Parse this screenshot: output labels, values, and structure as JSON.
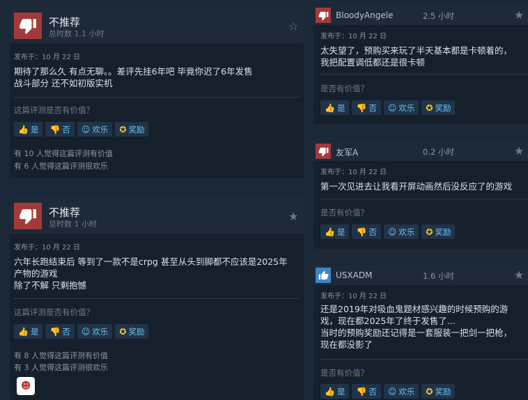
{
  "left_reviews": [
    {
      "verdict": "不推荐",
      "hours": "总时数 1.1 小时",
      "posted": "发布于：10 月 22 日",
      "text": "期待了那么久 有点无聊。。差评先挂6年吧 毕竟你迟了6年发售\n战斗部分 还不如初版实机",
      "helpful_question": "这篇评测是否有价值？",
      "buttons": {
        "yes": "是",
        "no": "否",
        "funny": "欢乐",
        "award": "奖励"
      },
      "helpful_count": "有 10 人觉得这篇评测有价值",
      "funny_count": "有 6 人觉得这篇评测很欢乐",
      "thumb": "thumbs-down",
      "star": "star-outline-icon"
    },
    {
      "verdict": "不推荐",
      "hours": "总时数 1 小时",
      "posted": "发布于：10 月 22 日",
      "text": "六年长跑结束后 等到了一款不是crpg 甚至从头到脚都不应该是2025年\n产物的游戏\n除了不解 只剩抱憾",
      "helpful_question": "这篇评测是否有价值？",
      "buttons": {
        "yes": "是",
        "no": "否",
        "funny": "欢乐",
        "award": "奖励"
      },
      "helpful_count": "有 8 人觉得这篇评测有价值",
      "funny_count": "有 3 人觉得这篇评测很欢乐",
      "thumb": "thumbs-down",
      "star": "star-filled-icon"
    }
  ],
  "right_reviews": [
    {
      "user": "BloodyAngele",
      "hours": "2.5 小时",
      "posted": "发布于：10 月 22 日",
      "text": "太失望了，预购买来玩了半天基本都是卡顿着的，\n我把配置调低都还是很卡顿",
      "helpful_question": "是否有价值？",
      "buttons": {
        "yes": "是",
        "no": "否",
        "funny": "欢乐",
        "award": "奖励"
      },
      "thumb": "thumbs-down"
    },
    {
      "user": "友军A",
      "hours": "0.2 小时",
      "posted": "发布于：10 月 22 日",
      "text": "第一次见进去让我看开屏动画然后没反应了的游戏",
      "helpful_question": "是否有价值？",
      "buttons": {
        "yes": "是",
        "no": "否",
        "funny": "欢乐",
        "award": "奖励"
      },
      "thumb": "thumbs-down"
    },
    {
      "user": "USXADM",
      "hours": "1.6 小时",
      "posted": "发布于：10 月 22 日",
      "text": "还是2019年对吸血鬼题材感兴趣的时候预购的游\n戏，现在都2025年了终于发售了...\n当时的预购奖励还记得是一套服装一把剑一把枪，\n现在都没影了",
      "helpful_question": "是否有价值？",
      "buttons": {
        "yes": "是",
        "no": "否",
        "funny": "欢乐",
        "award": "奖励"
      },
      "thumb": "thumbs-up"
    }
  ],
  "colors": {
    "accent": "#67c1f5",
    "down": "#a33a3a",
    "up": "#3a86c8",
    "award": "#ffcc35"
  }
}
